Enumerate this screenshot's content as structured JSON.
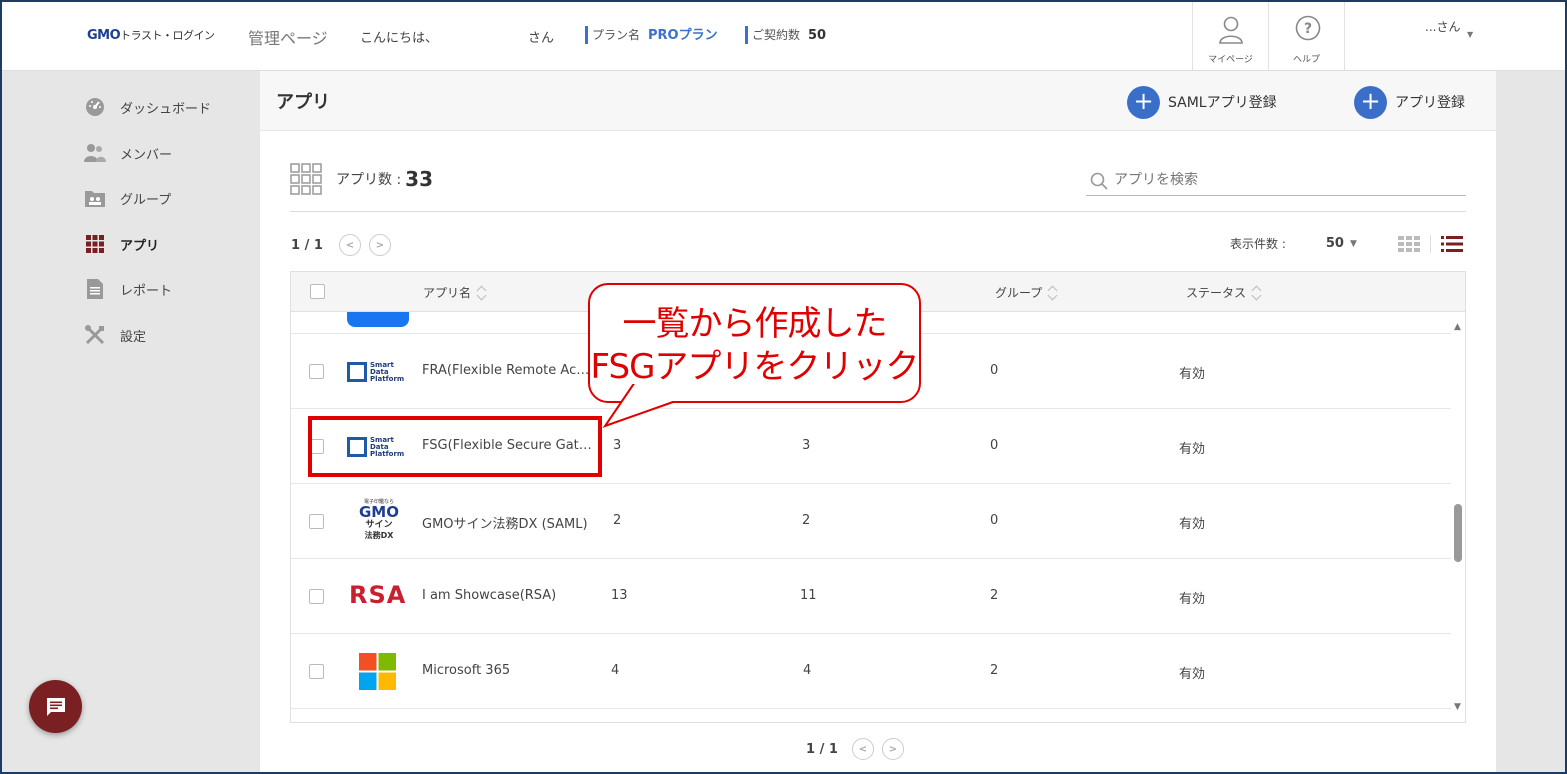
{
  "header": {
    "logo_main": "GMO",
    "logo_sub": "トラスト・ログイン",
    "title": "管理ページ",
    "greeting": "こんにちは、",
    "san": "さん",
    "plan_label": "プラン名",
    "plan_value": "PROプラン",
    "contract_label": "ご契約数",
    "contract_value": "50",
    "mypage_label": "マイページ",
    "help_label": "ヘルプ",
    "user_name": "...さん"
  },
  "sidebar": {
    "items": [
      {
        "label": "ダッシュボード",
        "icon": "dashboard-icon"
      },
      {
        "label": "メンバー",
        "icon": "members-icon"
      },
      {
        "label": "グループ",
        "icon": "group-icon"
      },
      {
        "label": "アプリ",
        "icon": "apps-icon",
        "active": true
      },
      {
        "label": "レポート",
        "icon": "report-icon"
      },
      {
        "label": "設定",
        "icon": "settings-icon"
      }
    ]
  },
  "main": {
    "title": "アプリ",
    "saml_button": "SAMLアプリ登録",
    "app_button": "アプリ登録",
    "count_label": "アプリ数 :",
    "count_value": "33",
    "search_placeholder": "アプリを検索",
    "pager_top": "1 / 1",
    "perpage_label": "表示件数 :",
    "perpage_value": "50",
    "pager_bottom": "1 / 1"
  },
  "table": {
    "headers": {
      "name": "アプリ名",
      "group": "グループ",
      "status": "ステータス"
    },
    "rows": [
      {
        "name": "FRA(Flexible Remote Acces...",
        "col1": "",
        "col2": "",
        "groups": "0",
        "status": "有効",
        "logo": "sdp"
      },
      {
        "name": "FSG(Flexible Secure Gatew...",
        "col1": "3",
        "col2": "3",
        "groups": "0",
        "status": "有効",
        "logo": "sdp"
      },
      {
        "name": "GMOサイン法務DX (SAML)",
        "col1": "2",
        "col2": "2",
        "groups": "0",
        "status": "有効",
        "logo": "gmo-sign"
      },
      {
        "name": "I am Showcase(RSA)",
        "col1": "13",
        "col2": "11",
        "groups": "2",
        "status": "有効",
        "logo": "rsa"
      },
      {
        "name": "Microsoft 365",
        "col1": "4",
        "col2": "4",
        "groups": "2",
        "status": "有効",
        "logo": "microsoft"
      }
    ],
    "sdp_logo_text": [
      "Smart",
      "Data",
      "Platform"
    ],
    "gmo_sign_text": [
      "電子印鑑なら",
      "GMO",
      "サイン",
      "法務DX"
    ],
    "rsa_text": "RSA"
  },
  "callout": {
    "line1": "一覧から作成した",
    "line2": "FSGアプリをクリック"
  },
  "colors": {
    "accent": "#3a6fc9",
    "sidebar_active": "#7a1f22",
    "highlight": "#e00000"
  }
}
